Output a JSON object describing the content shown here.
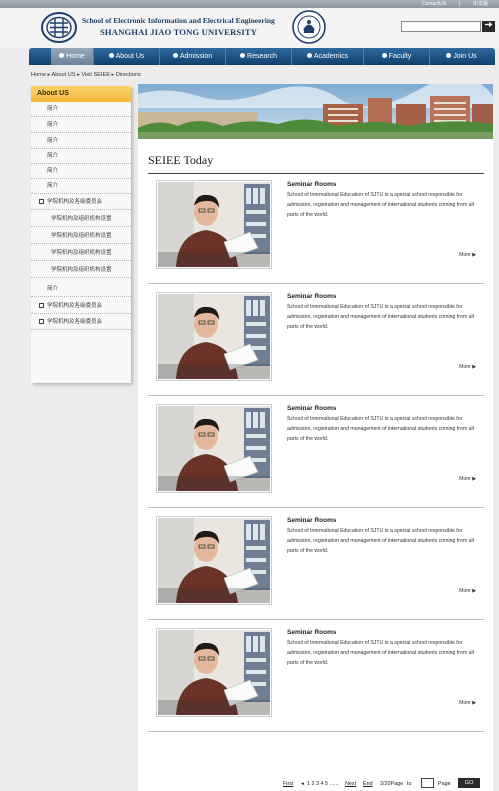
{
  "topbar": {
    "contact": "ContactUS",
    "sep": "|",
    "lang": "中文版"
  },
  "header": {
    "school_name": "School of Electronic Information and Electrical Engineering",
    "university_name": "SHANGHAI JIAO TONG UNIVERSITY",
    "search_placeholder": "",
    "search_button": "Go"
  },
  "nav": {
    "items": [
      "Home",
      "About Us",
      "Admission",
      "Research",
      "Academics",
      "Faculty",
      "Join Us"
    ],
    "active": "Home"
  },
  "breadcrumb": {
    "items": [
      "Home",
      "About US",
      "Visit SEIEE",
      "Directions"
    ],
    "separator": "▸"
  },
  "sidebar": {
    "title": "About US",
    "items": [
      {
        "label": "简介",
        "level": 0,
        "icon": false
      },
      {
        "label": "简介",
        "level": 0,
        "icon": false
      },
      {
        "label": "简介",
        "level": 0,
        "icon": false
      },
      {
        "label": "简介",
        "level": 0,
        "icon": false
      },
      {
        "label": "简介",
        "level": 0,
        "icon": false
      },
      {
        "label": "简介",
        "level": 0,
        "icon": false
      },
      {
        "label": "学院机构及各级委员会",
        "level": 0,
        "icon": true
      },
      {
        "label": "学院机构及组织机构设置",
        "level": 1,
        "icon": false
      },
      {
        "label": "学院机构及组织机构设置",
        "level": 1,
        "icon": false
      },
      {
        "label": "学院机构及组织机构设置",
        "level": 1,
        "icon": false
      },
      {
        "label": "学院机构及组织机构设置",
        "level": 1,
        "icon": false
      },
      {
        "label": "简介",
        "level": 0,
        "icon": false
      },
      {
        "label": "学院机构及各级委员会",
        "level": 0,
        "icon": true
      },
      {
        "label": "学院机构及各级委员会",
        "level": 0,
        "icon": true
      }
    ]
  },
  "main": {
    "title": "SEIEE Today",
    "entries": [
      {
        "title": "Seminar Rooms",
        "desc": "School of International Education of SJTU is a special school responsible for admission, registration and management of international students coming from all parts of the world.",
        "more": "More"
      },
      {
        "title": "Seminar Rooms",
        "desc": "School of International Education of SJTU is a special school responsible for admission, registration and management of international students coming from all parts of the world.",
        "more": "More"
      },
      {
        "title": "Seminar Rooms",
        "desc": "School of International Education of SJTU is a special school responsible for admission, registration and management of international students coming from all parts of the world.",
        "more": "More"
      },
      {
        "title": "Seminar Rooms",
        "desc": "School of International Education of SJTU is a special school responsible for admission, registration and management of international students coming from all parts of the world.",
        "more": "More"
      },
      {
        "title": "Seminar Rooms",
        "desc": "School of International Education of SJTU is a special school responsible for admission, registration and management of international students coming from all parts of the world.",
        "more": "More"
      }
    ]
  },
  "pagination": {
    "first": "First",
    "prev_arrow": "◂",
    "pages": "1 2 3 4 5 ......",
    "next": "Next",
    "end": "End",
    "page_info": "2/20Page",
    "to_label": "to",
    "page_label": "Page",
    "go_label": "GO"
  },
  "colors": {
    "nav": "#1b4d80",
    "sidebar_head": "#f5bf45",
    "page_bg": "#ececec"
  }
}
